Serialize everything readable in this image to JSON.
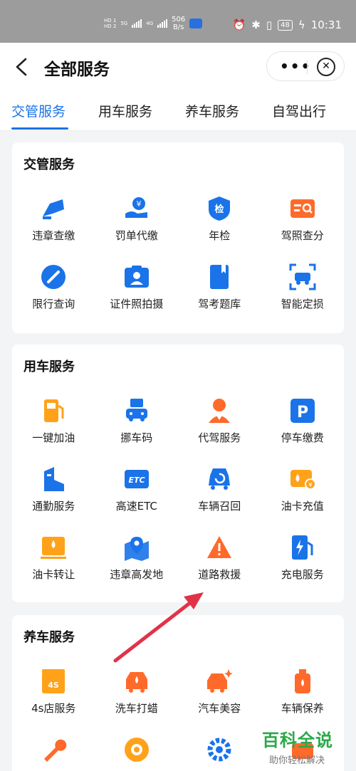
{
  "status_bar": {
    "hd1": "HD 1",
    "hd2": "HD 2",
    "net1": "5G",
    "net2": "4G",
    "speed_value": "506",
    "speed_unit": "B/s",
    "battery": "48",
    "time": "10:31"
  },
  "header": {
    "title": "全部服务",
    "more": "•••",
    "close": "✕"
  },
  "tabs": [
    {
      "label": "交管服务",
      "active": true
    },
    {
      "label": "用车服务",
      "active": false
    },
    {
      "label": "养车服务",
      "active": false
    },
    {
      "label": "自驾出行",
      "active": false
    }
  ],
  "sections": [
    {
      "title": "交管服务",
      "items": [
        {
          "label": "违章查缴",
          "icon": "camera-icon"
        },
        {
          "label": "罚单代缴",
          "icon": "yuan-hand-icon"
        },
        {
          "label": "年检",
          "icon": "shield-check-icon"
        },
        {
          "label": "驾照查分",
          "icon": "license-search-icon"
        },
        {
          "label": "限行查询",
          "icon": "no-entry-icon"
        },
        {
          "label": "证件照拍摄",
          "icon": "id-photo-icon"
        },
        {
          "label": "驾考题库",
          "icon": "book-icon"
        },
        {
          "label": "智能定损",
          "icon": "car-scan-icon"
        }
      ]
    },
    {
      "title": "用车服务",
      "items": [
        {
          "label": "一键加油",
          "icon": "fuel-pump-icon"
        },
        {
          "label": "挪车码",
          "icon": "move-car-icon"
        },
        {
          "label": "代驾服务",
          "icon": "driver-icon"
        },
        {
          "label": "停车缴费",
          "icon": "parking-icon"
        },
        {
          "label": "通勤服务",
          "icon": "building-icon"
        },
        {
          "label": "高速ETC",
          "icon": "etc-icon"
        },
        {
          "label": "车辆召回",
          "icon": "car-recall-icon"
        },
        {
          "label": "油卡充值",
          "icon": "oil-card-icon"
        },
        {
          "label": "油卡转让",
          "icon": "oil-card-transfer-icon"
        },
        {
          "label": "违章高发地",
          "icon": "map-pin-icon"
        },
        {
          "label": "道路救援",
          "icon": "warning-icon"
        },
        {
          "label": "充电服务",
          "icon": "charging-icon"
        }
      ]
    },
    {
      "title": "养车服务",
      "items": [
        {
          "label": "4s店服务",
          "icon": "4s-store-icon",
          "badge": "4S"
        },
        {
          "label": "洗车打蜡",
          "icon": "car-wash-icon"
        },
        {
          "label": "汽车美容",
          "icon": "car-beauty-icon"
        },
        {
          "label": "车辆保养",
          "icon": "oil-can-icon"
        },
        {
          "label": "",
          "icon": "wrench-icon"
        },
        {
          "label": "",
          "icon": "tire-icon"
        },
        {
          "label": "",
          "icon": "gear-icon"
        },
        {
          "label": "",
          "icon": "service-icon"
        }
      ]
    }
  ],
  "watermark": {
    "title": "百科全说",
    "subtitle": "助你轻松解决"
  },
  "colors": {
    "blue": "#1a73e8",
    "orange": "#ff6a2a",
    "amber": "#ffa21a",
    "annotation_arrow": "#e0334a"
  }
}
